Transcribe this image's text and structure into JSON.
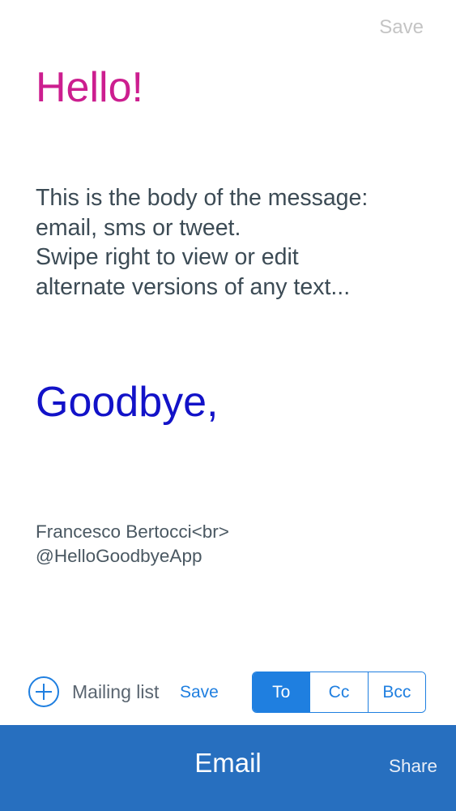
{
  "header": {
    "save_label": "Save"
  },
  "message": {
    "greeting": "Hello!",
    "body_lines": [
      "This is the body of the message:",
      "email, sms or tweet.",
      "Swipe right to view or edit",
      "alternate versions of any text..."
    ],
    "closing": "Goodbye,",
    "signature_lines": [
      "Francesco Bertocci<br>",
      "@HelloGoodbyeApp"
    ]
  },
  "recipients": {
    "add_icon": "plus-circle-icon",
    "mailing_list_label": "Mailing list",
    "save_label": "Save",
    "segments": [
      "To",
      "Cc",
      "Bcc"
    ],
    "selected_segment": "To"
  },
  "bottom_bar": {
    "send_label": "Email",
    "share_label": "Share"
  },
  "colors": {
    "greeting": "#cc1e8f",
    "closing": "#1212c8",
    "accent": "#1f7fe0",
    "bottom_bar": "#276fbf"
  }
}
